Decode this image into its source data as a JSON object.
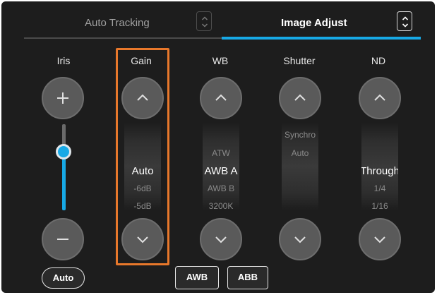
{
  "tabs": [
    {
      "label": "Auto Tracking",
      "active": false
    },
    {
      "label": "Image Adjust",
      "active": true
    }
  ],
  "columns": {
    "iris": {
      "title": "Iris",
      "plus_icon": "plus-icon",
      "minus_icon": "minus-icon",
      "auto_label": "Auto",
      "slider_level": 0.72
    },
    "gain": {
      "title": "Gain",
      "items": [
        "Auto",
        "-6dB",
        "-5dB"
      ],
      "selected": "Auto"
    },
    "wb": {
      "title": "WB",
      "items": [
        "ATW",
        "AWB A",
        "AWB B",
        "3200K"
      ],
      "selected": "AWB A"
    },
    "shutter": {
      "title": "Shutter",
      "items": [
        "Synchro",
        "Auto"
      ]
    },
    "nd": {
      "title": "ND",
      "items": [
        "Through",
        "1/4",
        "1/16"
      ],
      "selected": "Through"
    }
  },
  "bottom_buttons": {
    "awb": "AWB",
    "abb": "ABB"
  },
  "colors": {
    "accent": "#17a9e6",
    "highlight": "#e8782b",
    "background": "#1d1d1d"
  }
}
